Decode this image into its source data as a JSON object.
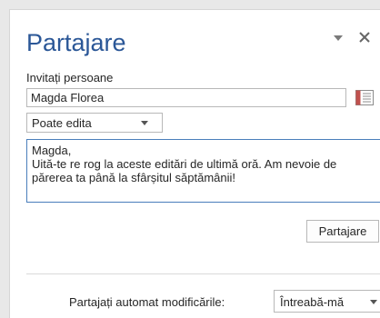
{
  "pane": {
    "title": "Partajare",
    "menu_icon": "chevron-down-icon",
    "close_icon": "close-icon"
  },
  "invite": {
    "label": "Invitați persoane",
    "name_value": "Magda Florea",
    "address_book_icon": "address-book-icon"
  },
  "permission": {
    "selected": "Poate edita"
  },
  "message": {
    "text": "Magda,\nUită-te re rog la aceste editări de ultimă oră. Am nevoie de părerea ta până la sfârșitul săptămânii!"
  },
  "share_button": {
    "label": "Partajare"
  },
  "auto_share": {
    "label": "Partajați automat modificările:",
    "selected": "Întreabă-mă"
  },
  "colors": {
    "title": "#2b5797",
    "message_border": "#4a7ebb",
    "address_book_accent": "#c0504d"
  }
}
